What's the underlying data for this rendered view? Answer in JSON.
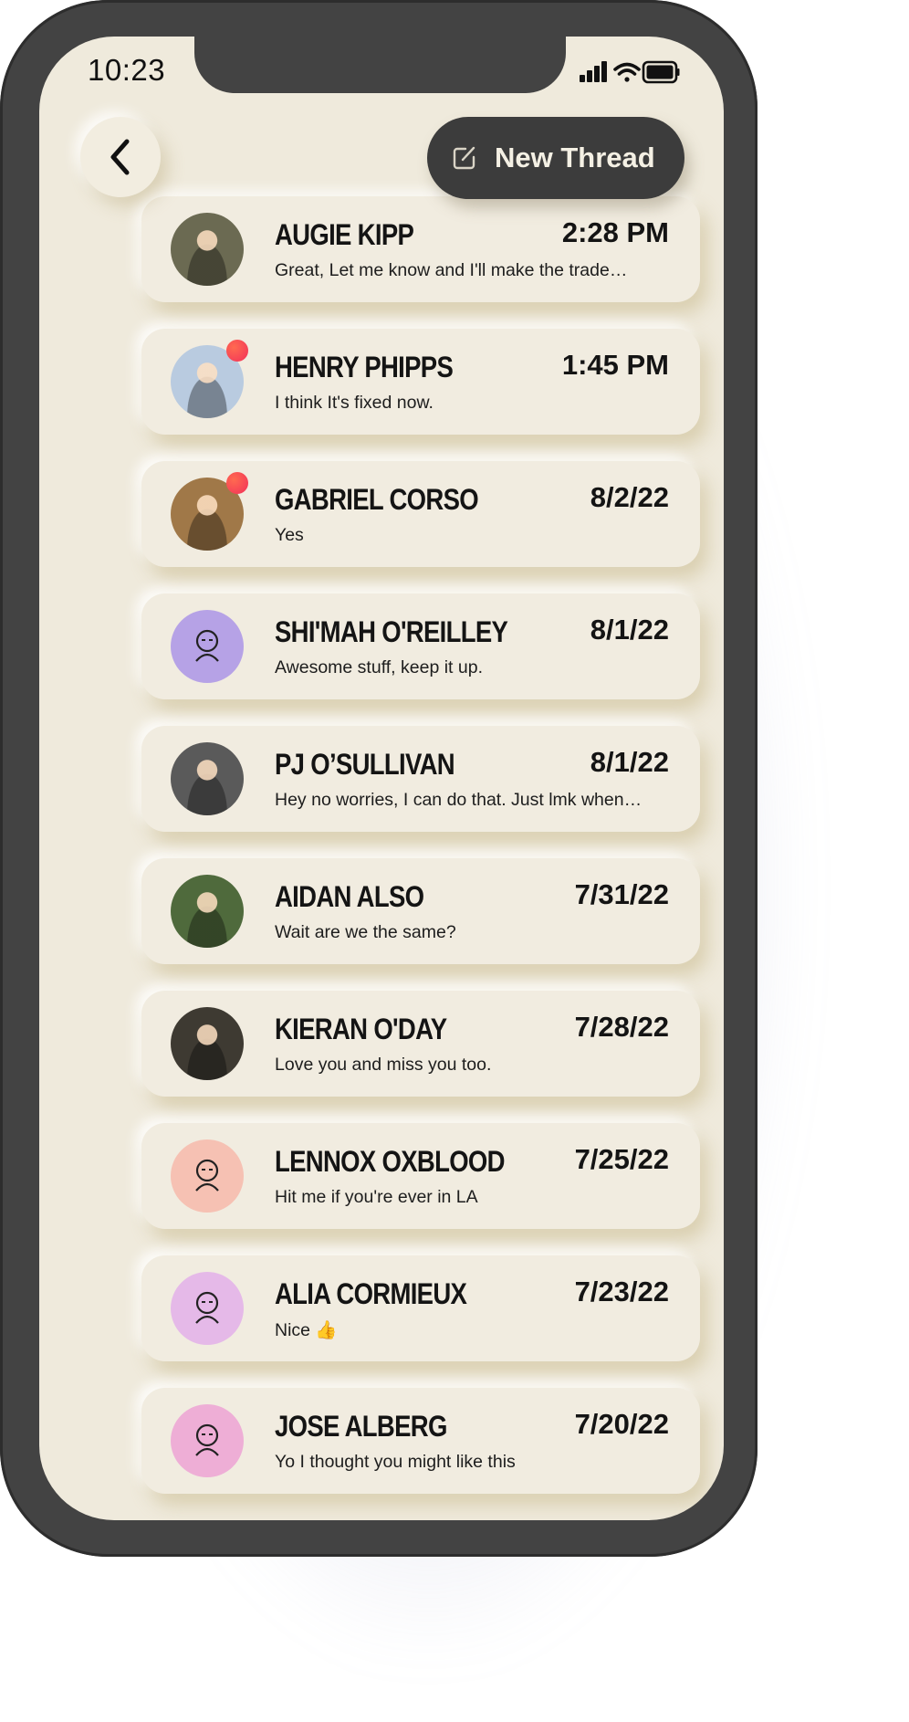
{
  "status_bar": {
    "time": "10:23"
  },
  "header": {
    "new_thread_label": "New Thread"
  },
  "threads": [
    {
      "name": "AUGIE KIPP",
      "date": "2:28 PM",
      "message": "Great, Let me know and I'll make the trade…",
      "unread": false,
      "avatar": "photo",
      "avatar_color": "#6b6a52"
    },
    {
      "name": "HENRY PHIPPS",
      "date": "1:45 PM",
      "message": "I think It's fixed now.",
      "unread": true,
      "avatar": "photo",
      "avatar_color": "#b9cbe0"
    },
    {
      "name": "GABRIEL CORSO",
      "date": "8/2/22",
      "message": "Yes",
      "unread": true,
      "avatar": "photo",
      "avatar_color": "#a07848"
    },
    {
      "name": "SHI'MAH O'REILLEY",
      "date": "8/1/22",
      "message": "Awesome stuff, keep it up.",
      "unread": false,
      "avatar": "illustration",
      "avatar_color": "#b6a2e6"
    },
    {
      "name": "PJ O’SULLIVAN",
      "date": "8/1/22",
      "message": "Hey no worries, I can do that.  Just lmk when…",
      "unread": false,
      "avatar": "photo",
      "avatar_color": "#5a5a5a"
    },
    {
      "name": "AIDAN ALSO",
      "date": "7/31/22",
      "message": "Wait are we the same?",
      "unread": false,
      "avatar": "photo",
      "avatar_color": "#4f6a3c"
    },
    {
      "name": "KIERAN O'DAY",
      "date": "7/28/22",
      "message": "Love you and miss you too.",
      "unread": false,
      "avatar": "photo",
      "avatar_color": "#3e3a32"
    },
    {
      "name": "LENNOX OXBLOOD",
      "date": "7/25/22",
      "message": "Hit me if you're ever in LA",
      "unread": false,
      "avatar": "illustration",
      "avatar_color": "#f6c1b3"
    },
    {
      "name": "ALIA CORMIEUX",
      "date": "7/23/22",
      "message": "Nice 👍",
      "unread": false,
      "avatar": "illustration",
      "avatar_color": "#e5b9e8"
    },
    {
      "name": "JOSE ALBERG",
      "date": "7/20/22",
      "message": "Yo I thought you might like this",
      "unread": false,
      "avatar": "illustration",
      "avatar_color": "#eeaed6"
    }
  ],
  "colors": {
    "screen_bg": "#efeadc",
    "frame": "#434343",
    "unread_dot": "#f2305a"
  }
}
